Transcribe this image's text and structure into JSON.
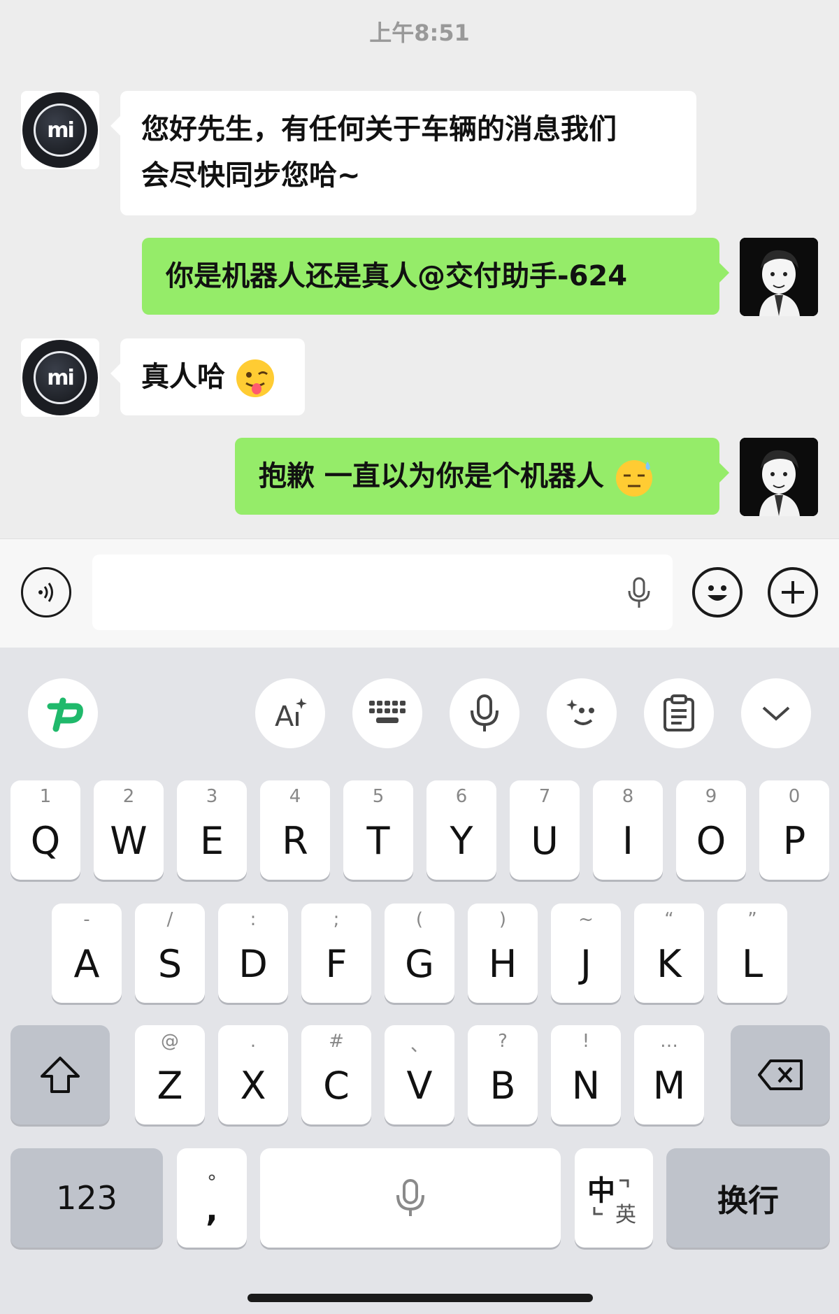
{
  "status": {
    "time": "上午8:51"
  },
  "messages": [
    {
      "side": "in",
      "text_line1": "您好先生，有任何关于车辆的消息我们",
      "text_line2": "会尽快同步您哈~"
    },
    {
      "side": "out",
      "text": "你是机器人还是真人@交付助手-624"
    },
    {
      "side": "in",
      "text": "真人哈",
      "emoji": "winking-tongue-emoji"
    },
    {
      "side": "out",
      "text": "抱歉 一直以为你是个机器人",
      "emoji": "downcast-sweat-emoji"
    }
  ],
  "avatars": {
    "bot_logo": "mi",
    "user": "user-avatar"
  },
  "input": {
    "placeholder": ""
  },
  "keyboard": {
    "toolbar": [
      "app-logo-icon",
      "ai-write-icon",
      "keyboard-layout-icon",
      "voice-icon",
      "emoji-face-icon",
      "clipboard-icon",
      "collapse-icon"
    ],
    "row1": [
      {
        "key": "Q",
        "hint": "1"
      },
      {
        "key": "W",
        "hint": "2"
      },
      {
        "key": "E",
        "hint": "3"
      },
      {
        "key": "R",
        "hint": "4"
      },
      {
        "key": "T",
        "hint": "5"
      },
      {
        "key": "Y",
        "hint": "6"
      },
      {
        "key": "U",
        "hint": "7"
      },
      {
        "key": "I",
        "hint": "8"
      },
      {
        "key": "O",
        "hint": "9"
      },
      {
        "key": "P",
        "hint": "0"
      }
    ],
    "row2": [
      {
        "key": "A",
        "hint": "-"
      },
      {
        "key": "S",
        "hint": "/"
      },
      {
        "key": "D",
        "hint": ":"
      },
      {
        "key": "F",
        "hint": ";"
      },
      {
        "key": "G",
        "hint": "("
      },
      {
        "key": "H",
        "hint": ")"
      },
      {
        "key": "J",
        "hint": "~"
      },
      {
        "key": "K",
        "hint": "“"
      },
      {
        "key": "L",
        "hint": "”"
      }
    ],
    "row3": [
      {
        "key": "Z",
        "hint": "@"
      },
      {
        "key": "X",
        "hint": "."
      },
      {
        "key": "C",
        "hint": "#"
      },
      {
        "key": "V",
        "hint": "、"
      },
      {
        "key": "B",
        "hint": "?"
      },
      {
        "key": "N",
        "hint": "!"
      },
      {
        "key": "M",
        "hint": "…"
      }
    ],
    "numbers_label": "123",
    "punct_top": "°",
    "punct_bottom": ",",
    "lang_zh": "中",
    "lang_en": "英",
    "enter_label": "换行"
  }
}
